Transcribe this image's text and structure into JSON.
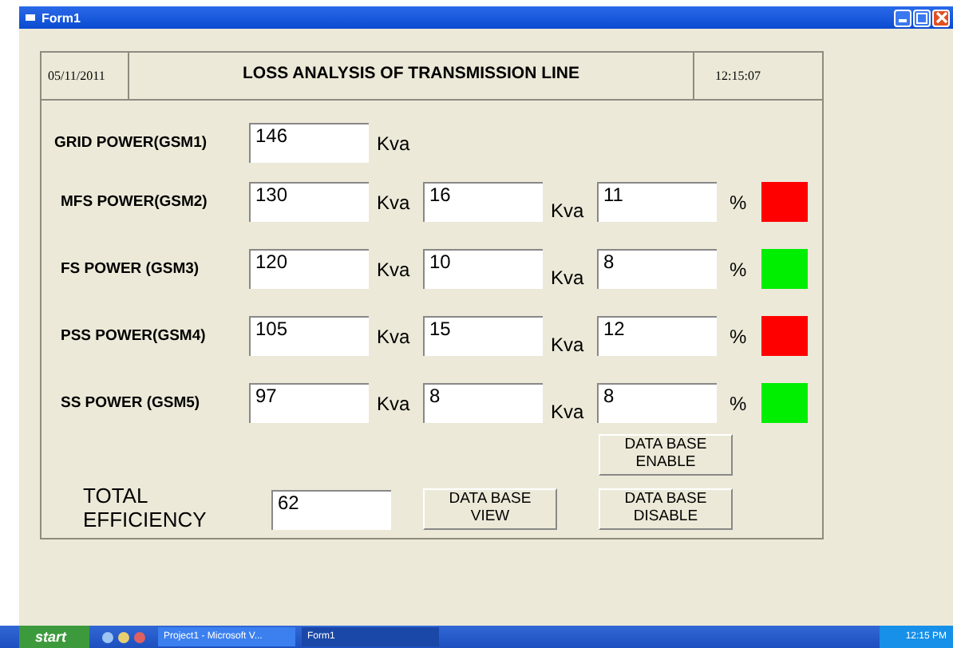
{
  "window": {
    "title": "Form1"
  },
  "header": {
    "date": "05/11/2011",
    "title": "LOSS ANALYSIS OF TRANSMISSION LINE",
    "time": "12:15:07"
  },
  "grid": {
    "label": "GRID POWER(GSM1)",
    "value": "146",
    "unit": "Kva"
  },
  "rows": [
    {
      "label": "MFS POWER(GSM2)",
      "power": "130",
      "unit1": "Kva",
      "loss": "16",
      "unit2": "Kva",
      "percent": "11",
      "percent_unit": "%",
      "color": "#ff0000"
    },
    {
      "label": "FS POWER (GSM3)",
      "power": "120",
      "unit1": "Kva",
      "loss": "10",
      "unit2": "Kva",
      "percent": "8",
      "percent_unit": "%",
      "color": "#00ee00"
    },
    {
      "label": "PSS POWER(GSM4)",
      "power": "105",
      "unit1": "Kva",
      "loss": "15",
      "unit2": "Kva",
      "percent": "12",
      "percent_unit": "%",
      "color": "#ff0000"
    },
    {
      "label": "SS POWER (GSM5)",
      "power": "97",
      "unit1": "Kva",
      "loss": "8",
      "unit2": "Kva",
      "percent": "8",
      "percent_unit": "%",
      "color": "#00ee00"
    }
  ],
  "total": {
    "label": "TOTAL EFFICIENCY",
    "value": "62"
  },
  "buttons": {
    "enable": "DATA BASE ENABLE",
    "view": "DATA BASE VIEW",
    "disable": "DATA BASE DISABLE"
  },
  "taskbar": {
    "start": "start",
    "tasks": [
      {
        "label": "Project1 - Microsoft V...",
        "selected": false
      },
      {
        "label": "Form1",
        "selected": true
      }
    ],
    "clock": "12:15 PM"
  }
}
